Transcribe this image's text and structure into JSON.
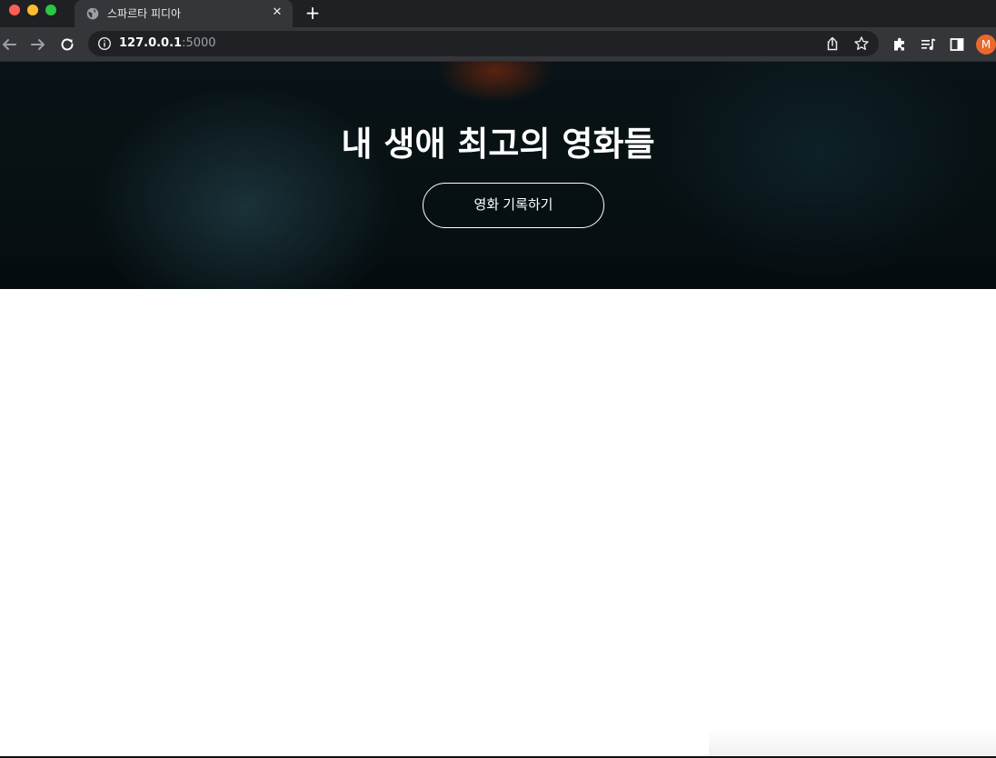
{
  "browser": {
    "tab": {
      "title": "스파르타 피디아",
      "favicon": "globe-icon"
    },
    "url": {
      "host": "127.0.0.1",
      "port": ":5000"
    },
    "profile_initial": "M",
    "colors": {
      "tabstrip": "#1f2023",
      "toolbar": "#35363a",
      "omnibox": "#202124",
      "avatar": "#e8692b"
    }
  },
  "hero": {
    "title": "내 생애 최고의 영화들",
    "button_label": "영화 기록하기"
  }
}
